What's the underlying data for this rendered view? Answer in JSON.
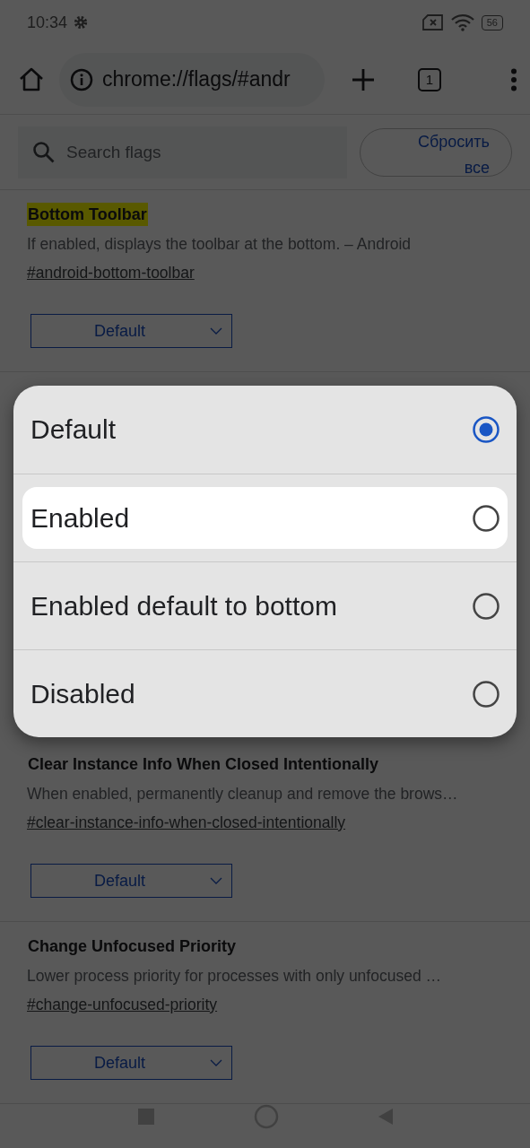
{
  "status_bar": {
    "time": "10:34",
    "battery": "56"
  },
  "toolbar": {
    "url": "chrome://flags/#andr",
    "tab_count": "1"
  },
  "search": {
    "placeholder": "Search flags",
    "reset_button": "Сбросить все"
  },
  "flags_above": [
    {
      "title": "Bottom Toolbar",
      "highlighted": true,
      "description": "If enabled, displays the toolbar at the bottom. – Android",
      "link": "#android-bottom-toolbar",
      "value": "Default"
    }
  ],
  "flags_below": [
    {
      "title": "Clear Instance Info When Closed Intentionally",
      "highlighted": false,
      "description": "When enabled, permanently cleanup and remove the brows…",
      "link": "#clear-instance-info-when-closed-intentionally",
      "value": "Default"
    },
    {
      "title": "Change Unfocused Priority",
      "highlighted": false,
      "description": "Lower process priority for processes with only unfocused …",
      "link": "#change-unfocused-priority",
      "value": "Default"
    }
  ],
  "dialog": {
    "options": [
      {
        "label": "Default",
        "selected": true,
        "focused": false
      },
      {
        "label": "Enabled",
        "selected": false,
        "focused": true
      },
      {
        "label": "Enabled default to bottom",
        "selected": false,
        "focused": false
      },
      {
        "label": "Disabled",
        "selected": false,
        "focused": false
      }
    ]
  }
}
